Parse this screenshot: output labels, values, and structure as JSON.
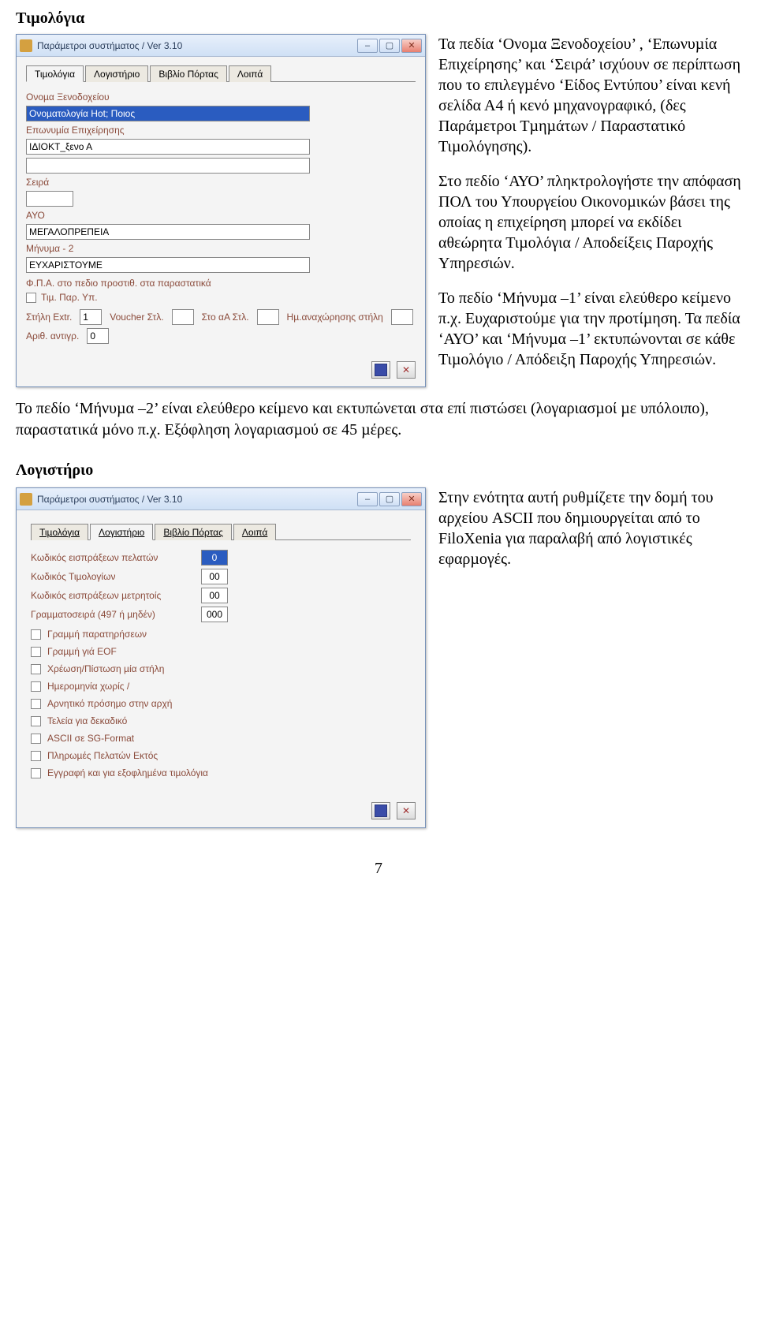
{
  "heading1": "Τιµολόγια",
  "right_paras": {
    "p1": "Τα πεδία ‘Ονοµα Ξενοδοχείου’ , ‘Επωνυµία Επιχείρησης’ και ‘Σειρά’ ισχύουν σε περίπτωση που το επιλεγµένο ‘Είδος Εντύπου’ είναι κενή σελίδα Α4 ή κενό µηχανογραφικό, (δες Παράµετροι Τµηµάτων / Παραστατικό Τιµολόγησης).",
    "p2": "Στο πεδίο ‘ΑΥΟ’ πληκτρολογήστε την απόφαση ΠΟΛ του Υπουργείου Οικονοµικών βάσει της οποίας η επιχείρηση µπορεί να εκδίδει αθεώρητα Τιµολόγια / Αποδείξεις Παροχής Υπηρεσιών.",
    "p3": "Το πεδίο ‘Μήνυµα –1’  είναι ελεύθερο κείµενο π.χ. Ευχαριστούµε για την προτίµηση. Τα πεδία ‘ΑΥΟ’ και ‘Μήνυµα –1’ εκτυπώνονται σε κάθε Τιµολόγιο / Απόδειξη Παροχής Υπηρεσιών."
  },
  "mid_para": "Το πεδίο ‘Μήνυµα –2’ είναι ελεύθερο κείµενο και εκτυπώνεται στα επί πιστώσει (λογαριασµοί µε υπόλοιπο), παραστατικά µόνο π.χ. Εξόφληση λογαριασµού  σε 45 µέρες.",
  "heading2": "Λογιστήριο",
  "right_para2": "Στην ενότητα αυτή ρυθµίζετε την δοµή του αρχείου ASCII που δηµιουργείται από  το FiloXenia για παραλαβή από λογιστικές εφαρµογές.",
  "win_common": {
    "title": "Παράµετροι συστήµατος               / Ver 3.10"
  },
  "win1": {
    "tabs": [
      "Τιµολόγια",
      "Λογιστήριο",
      "Βιβλίο Πόρτας",
      "Λοιπά"
    ],
    "labels": {
      "hotel": "Ονοµα Ξενοδοχείου",
      "hotel_val": "Ονοµατολογία Hot; Ποιος",
      "busname": "Επωνυµία Επιχείρησης",
      "busname_val": "ΙΔΙΟΚΤ_ξενο Α",
      "series": "Σειρά",
      "ayo": "ΑΥΟ",
      "msg1": "ΜΕΓΑΛΟΠΡΕΠΕΙΑ",
      "msg2": "Μήνυµα - 2",
      "thanks": "ΕΥΧΑΡΙΣΤΟΥΜΕ",
      "fpalbl": "Φ.Π.Α. στο πεδιο προστιθ. στα παραστατικά",
      "fpa_cb": "Τιµ. Παρ. Υπ.",
      "st1": "Στήλη Extr.",
      "v1": "1",
      "st2": "Voucher Στλ.",
      "st3": "Στο αΑ Στλ.",
      "st4": "Ηµ.αναχώρησης στήλη",
      "amt": "Αριθ. αντιγρ.",
      "amt_v": "0"
    }
  },
  "win2": {
    "tabs": [
      "Τιµολόγια",
      "Λογιστήριο",
      "Βιβλίο Πόρτας",
      "Λοιπά"
    ],
    "fields": {
      "f1": "Κωδικός εισπράξεων πελατών",
      "v1": "0",
      "f2": "Κωδικός Τιµολογίων",
      "v2": "00",
      "f3": "Κωδικός εισπράξεων µετρητοίς",
      "v3": "00",
      "f4": "Γραµµατοσειρά (497 ή µηδέν)",
      "v4": "000"
    },
    "checks": {
      "c1": "Γραµµή παρατηρήσεων",
      "c2": "Γραµµή γιά EOF",
      "c3": "Χρέωση/Πίστωση µία στήλη",
      "c4": "Ηµεροµηνία χωρίς /",
      "c5": "Αρνητικό πρόσηµο στην αρχή",
      "c6": "Τελεία για δεκαδικό",
      "c7": "ASCII σε SG-Format",
      "c8": "Πληρωµές Πελατών Εκτός",
      "c9": "Εγγραφή και για εξοφληµένα τιµολόγια"
    }
  },
  "page_number": "7"
}
